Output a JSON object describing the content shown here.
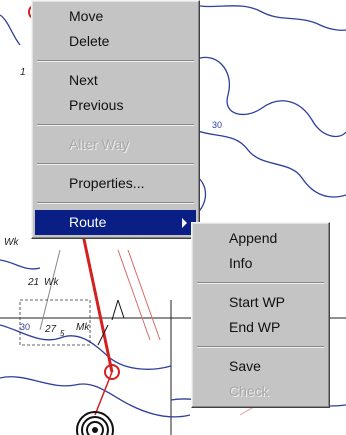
{
  "map": {
    "labels": {
      "depth_30_a": "30",
      "depth_30_b": "30",
      "label_wk": "Wk",
      "label_wk_left": "Wk",
      "label_21": "21",
      "label_27": "27",
      "label_5": "5",
      "label_mk": "Mk",
      "label_1": "1"
    }
  },
  "context_menu": {
    "items": [
      {
        "label": "Move"
      },
      {
        "label": "Delete"
      },
      {
        "label": "Next"
      },
      {
        "label": "Previous"
      },
      {
        "label": "Alter Way"
      },
      {
        "label": "Properties..."
      },
      {
        "label": "Route"
      }
    ]
  },
  "route_submenu": {
    "items": [
      {
        "label": "Append"
      },
      {
        "label": "Info"
      },
      {
        "label": "Start WP"
      },
      {
        "label": "End WP"
      },
      {
        "label": "Save"
      },
      {
        "label": "Check"
      }
    ]
  },
  "colors": {
    "menu_bg": "#c4c4c4",
    "highlight": "#0a1f85",
    "route_line": "#d42020",
    "contour": "#2f3f9c"
  }
}
